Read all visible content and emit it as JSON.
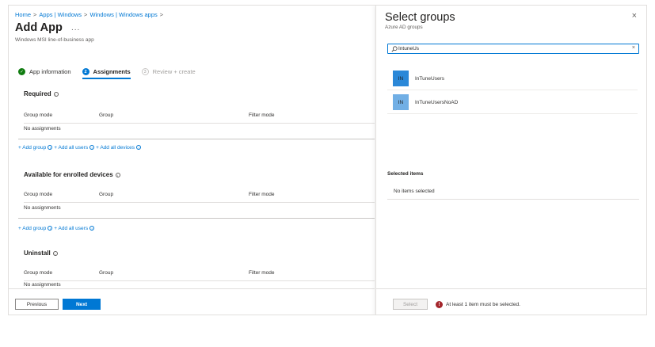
{
  "breadcrumb": [
    "Home",
    "Apps | Windows",
    "Windows | Windows apps"
  ],
  "breadcrumb_separator": ">",
  "page": {
    "title": "Add App",
    "more": "...",
    "subtitle": "Windows MSI line-of-business app"
  },
  "steps": [
    {
      "label": "App information",
      "state": "done",
      "glyph": "✓"
    },
    {
      "label": "Assignments",
      "state": "active",
      "glyph": "2"
    },
    {
      "label": "Review + create",
      "state": "future",
      "glyph": "3"
    }
  ],
  "columns": {
    "mode": "Group mode",
    "group": "Group",
    "filter": "Filter mode"
  },
  "sections": {
    "required": {
      "title": "Required",
      "empty": "No assignments",
      "links": {
        "add_group": "+ Add group",
        "add_users": "+ Add all users",
        "add_devices": "+ Add all devices"
      }
    },
    "available": {
      "title": "Available for enrolled devices",
      "empty": "No assignments",
      "links": {
        "add_group": "+ Add group",
        "add_users": "+ Add all users"
      }
    },
    "uninstall": {
      "title": "Uninstall",
      "empty": "No assignments"
    }
  },
  "buttons": {
    "previous": "Previous",
    "next": "Next"
  },
  "panel": {
    "title": "Select groups",
    "subtitle": "Azure AD groups",
    "close": "×",
    "search_value": "IntuneUs",
    "clear": "×",
    "results": [
      {
        "initials": "IN",
        "name": "InTuneUsers",
        "avatar_color": "#2b88d8"
      },
      {
        "initials": "IN",
        "name": "InTuneUsersNoAD",
        "avatar_color": "#71afe5"
      }
    ],
    "selected_title": "Selected items",
    "selected_empty": "No items selected",
    "select_button": "Select",
    "error_glyph": "!",
    "error_text": "At least 1 item must be selected."
  },
  "colors": {
    "accent": "#0078d4",
    "success": "#107c10",
    "error": "#a4262c"
  },
  "icons": {
    "info": "info-icon",
    "search": "search-icon",
    "close": "close-icon",
    "error": "error-icon"
  }
}
